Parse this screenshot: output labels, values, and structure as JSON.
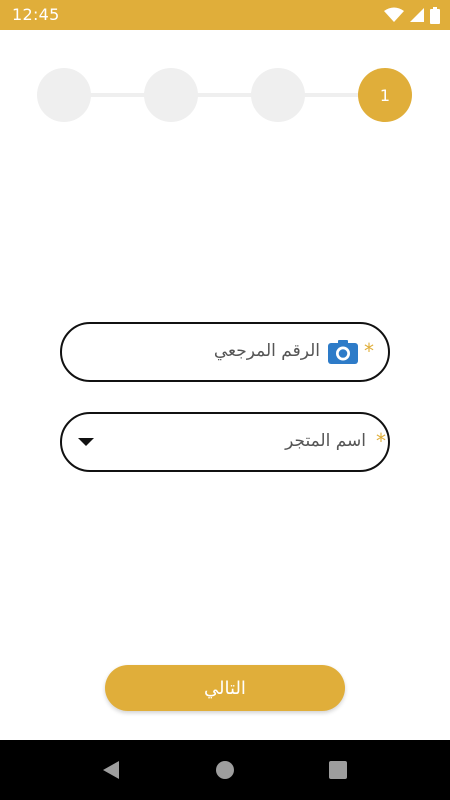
{
  "status_bar": {
    "time": "12:45",
    "icons": [
      "wifi-icon",
      "signal-icon",
      "battery-icon"
    ]
  },
  "stepper": {
    "steps": [
      {
        "label": "",
        "active": false
      },
      {
        "label": "",
        "active": false
      },
      {
        "label": "",
        "active": false
      },
      {
        "label": "1",
        "active": true
      }
    ]
  },
  "form": {
    "reference": {
      "label": "الرقم المرجعي",
      "required_mark": "*",
      "icon": "camera-icon"
    },
    "store": {
      "label": "اسم المتجر",
      "required_mark": "*",
      "icon": "dropdown-arrow-icon"
    }
  },
  "actions": {
    "next_label": "التالي"
  },
  "colors": {
    "accent": "#E0AE3A",
    "step_inactive": "#EFEFEF",
    "camera_icon": "#2D7BC8"
  },
  "nav_bar": {
    "icons": [
      "back-icon",
      "home-icon",
      "recents-icon"
    ]
  }
}
